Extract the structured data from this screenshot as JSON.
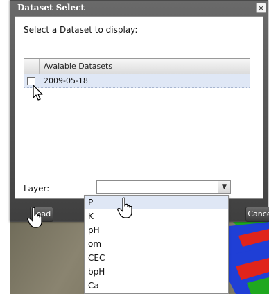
{
  "dialog": {
    "title": "Dataset Select",
    "close_glyph": "×",
    "prompt": "Select a Dataset to display:"
  },
  "grid": {
    "column_header": "Avalable Datasets",
    "rows": [
      {
        "label": "2009-05-18"
      }
    ]
  },
  "layer": {
    "label": "Layer:",
    "value": "",
    "options": [
      "P",
      "K",
      "pH",
      "om",
      "CEC",
      "bpH",
      "Ca"
    ],
    "highlighted": "P"
  },
  "buttons": {
    "load_label": "Load",
    "cancel_label": "Cancel"
  },
  "icons": {
    "close": "close-icon",
    "dropdown_arrow": "chevron-down-icon",
    "arrow_cursor": "arrow-cursor-icon",
    "hand_cursor": "hand-pointer-icon"
  },
  "colors": {
    "titlebar": "#4f4f4f",
    "row_selected": "#dfe7f5",
    "field_red": "#e0241b",
    "field_blue": "#1f3fd6",
    "field_green": "#1fa81f"
  }
}
